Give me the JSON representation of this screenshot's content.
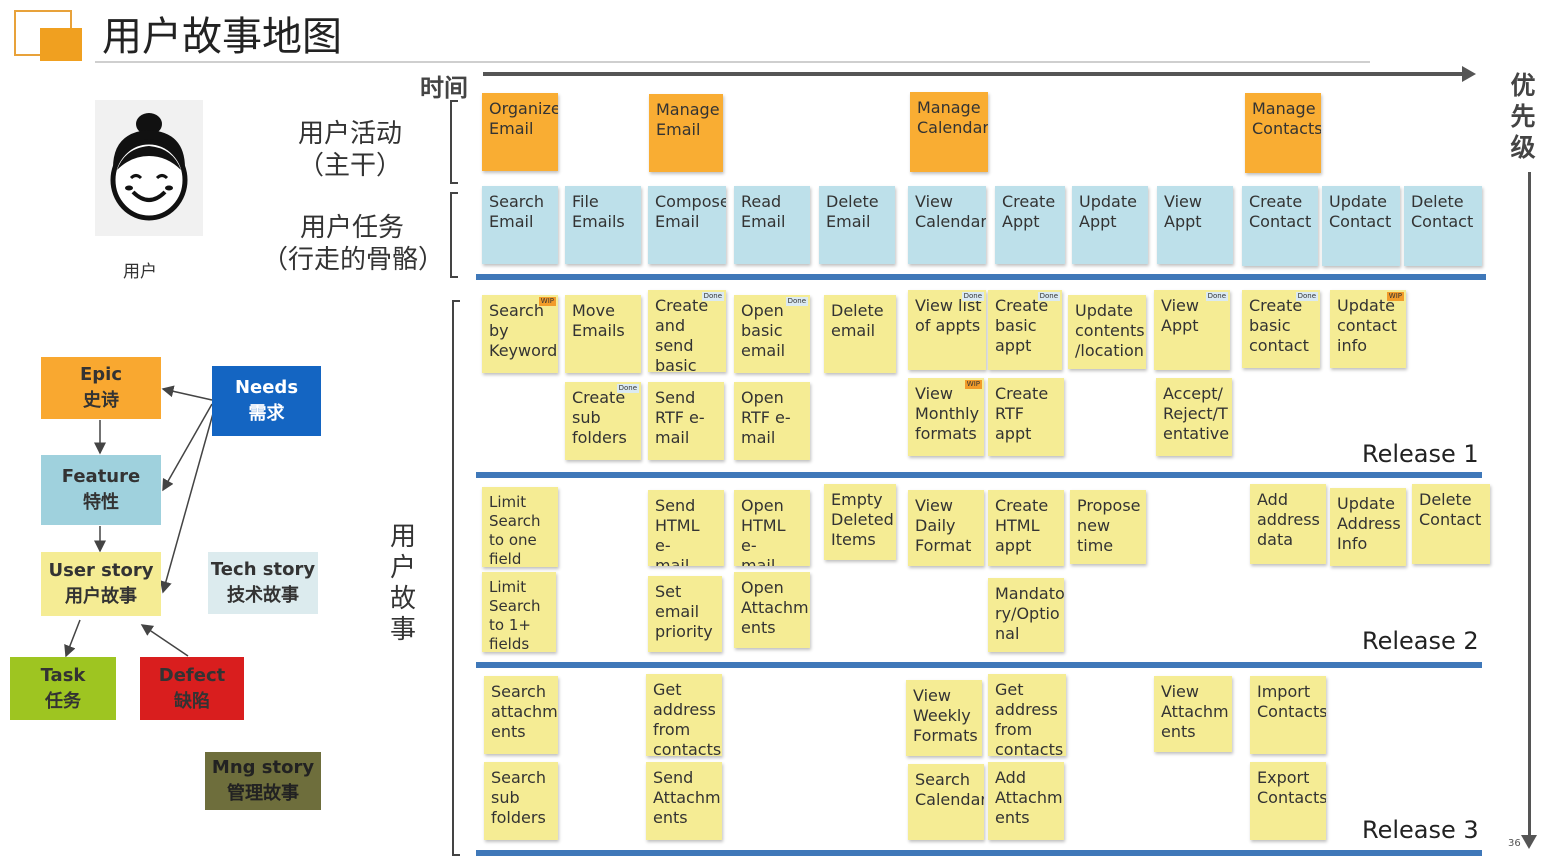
{
  "title": "用户故事地图",
  "axes": {
    "time": "时间",
    "priority": "优先级"
  },
  "page_number": "36",
  "persona": {
    "label": "用户",
    "icon": "user-avatar-icon"
  },
  "rows": {
    "activities": {
      "line1": "用户活动",
      "line2": "（主干）"
    },
    "tasks": {
      "line1": "用户任务",
      "line2": "（行走的骨骼）"
    },
    "stories": "用户故事"
  },
  "releases": [
    "Release 1",
    "Release 2",
    "Release 3"
  ],
  "activities": [
    "Organize\nEmail",
    "Manage\nEmail",
    "Manage\nCalendar",
    "Manage\nContacts"
  ],
  "tasks": [
    "Search\nEmail",
    "File\nEmails",
    "Compose\nEmail",
    "Read\nEmail",
    "Delete\nEmail",
    "View\nCalendar",
    "Create\nAppt",
    "Update\nAppt",
    "View\nAppt",
    "Create\nContact",
    "Update\nContact",
    "Delete\nContact"
  ],
  "stories": [
    {
      "text": "Search\nby\nKeyword",
      "badge": "WIP"
    },
    {
      "text": "Move\nEmails"
    },
    {
      "text": "Create\nand send\nbasic\nemail",
      "badge": "Done"
    },
    {
      "text": "Open\nbasic\nemail",
      "badge": "Done"
    },
    {
      "text": "Delete\nemail"
    },
    {
      "text": "View list\nof appts",
      "badge": "Done"
    },
    {
      "text": "Create\nbasic\nappt",
      "badge": "Done"
    },
    {
      "text": "Update\ncontents\n/location"
    },
    {
      "text": "View\nAppt",
      "badge": "Done"
    },
    {
      "text": "Create\nbasic\ncontact",
      "badge": "Done"
    },
    {
      "text": "Update\ncontact\ninfo",
      "badge": "WIP"
    },
    {
      "text": "Create\nsub\nfolders",
      "badge": "Done"
    },
    {
      "text": "Send\nRTF e-\nmail"
    },
    {
      "text": "Open\nRTF e-\nmail"
    },
    {
      "text": "View\nMonthly\nformats",
      "badge": "WIP"
    },
    {
      "text": "Create\nRTF appt"
    },
    {
      "text": "Accept/\nReject/T\nentative"
    },
    {
      "text": "Limit\nSearch\nto one\nfield"
    },
    {
      "text": "Send\nHTML e-\nmail"
    },
    {
      "text": "Open\nHTML e-\nmail"
    },
    {
      "text": "Empty\nDeleted\nItems"
    },
    {
      "text": "View\nDaily\nFormat"
    },
    {
      "text": "Create\nHTML\nappt"
    },
    {
      "text": "Propose\nnew time"
    },
    {
      "text": "Add\naddress\ndata"
    },
    {
      "text": "Update\nAddress\nInfo"
    },
    {
      "text": "Delete\nContact"
    },
    {
      "text": "Limit\nSearch\nto 1+\nfields"
    },
    {
      "text": "Set\nemail\npriority"
    },
    {
      "text": "Open\nAttachm\nents"
    },
    {
      "text": "Mandato\nry/Optio\nnal"
    },
    {
      "text": "Search\nattachm\nents"
    },
    {
      "text": "Get\naddress\nfrom\ncontacts"
    },
    {
      "text": "View\nWeekly\nFormats"
    },
    {
      "text": "Get\naddress\nfrom\ncontacts"
    },
    {
      "text": "View\nAttachm\nents"
    },
    {
      "text": "Import\nContacts"
    },
    {
      "text": "Search\nsub\nfolders"
    },
    {
      "text": "Send\nAttachm\nents"
    },
    {
      "text": "Search\nCalendar"
    },
    {
      "text": "Add\nAttachm\nents"
    },
    {
      "text": "Export\nContacts"
    }
  ],
  "legend": {
    "epic": {
      "en": "Epic",
      "zh": "史诗"
    },
    "needs": {
      "en": "Needs",
      "zh": "需求"
    },
    "feature": {
      "en": "Feature",
      "zh": "特性"
    },
    "user_story": {
      "en": "User story",
      "zh": "用户故事"
    },
    "tech_story": {
      "en": "Tech story",
      "zh": "技术故事"
    },
    "task": {
      "en": "Task",
      "zh": "任务"
    },
    "defect": {
      "en": "Defect",
      "zh": "缺陷"
    },
    "mng_story": {
      "en": "Mng story",
      "zh": "管理故事"
    }
  },
  "colors": {
    "activity": "#f9ad33",
    "task": "#bde0ea",
    "story": "#f5ec94",
    "release_line": "#3f78b9",
    "epic": "#f9a830",
    "needs": "#1465c2",
    "feature": "#9fd1dd",
    "tech": "#dcebee",
    "task_legend": "#9ec521",
    "defect": "#d91e1e",
    "mng": "#6e6e3c"
  }
}
